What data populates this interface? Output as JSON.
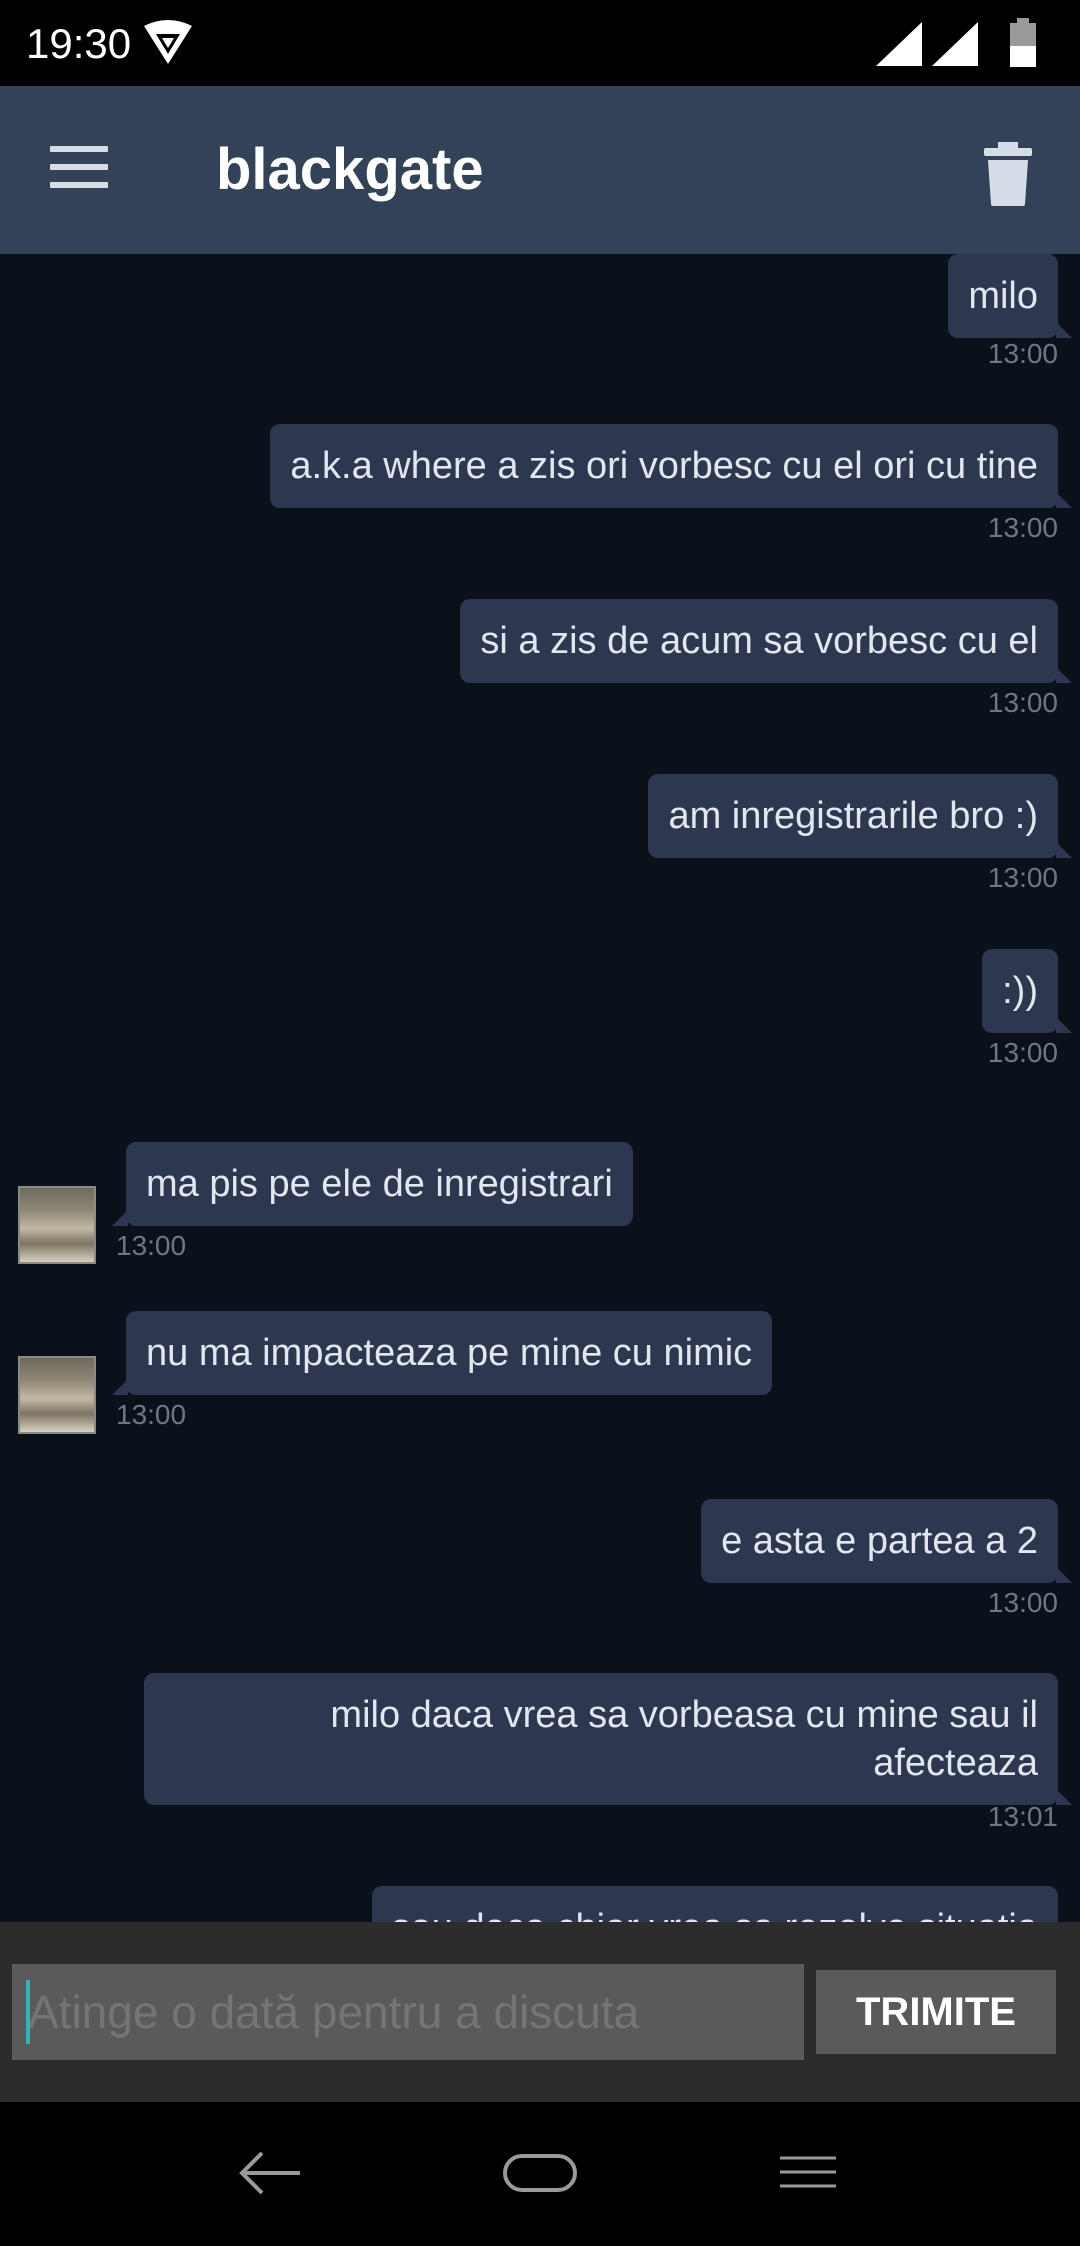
{
  "status_bar": {
    "time": "19:30"
  },
  "header": {
    "title": "blackgate"
  },
  "messages": [
    {
      "text": "milo",
      "time": "13:00"
    },
    {
      "text": "a.k.a where a zis ori vorbesc cu el ori cu tine",
      "time": "13:00"
    },
    {
      "text": "si a zis de acum sa vorbesc cu el",
      "time": "13:00"
    },
    {
      "text": "am inregistrarile bro :)",
      "time": "13:00"
    },
    {
      "text": ":))",
      "time": "13:00"
    },
    {
      "text": "ma pis pe ele de inregistrari",
      "time": "13:00"
    },
    {
      "text": "nu ma impacteaza pe mine cu nimic",
      "time": "13:00"
    },
    {
      "text": "e asta e partea a 2",
      "time": "13:00"
    },
    {
      "text": "milo daca vrea sa vorbeasa cu mine sau il afecteaza",
      "time": "13:01"
    },
    {
      "text": "sau daca chiar vrea sa rezolve situatia",
      "time": ""
    }
  ],
  "composer": {
    "placeholder": "Atinge o dată pentru a discuta",
    "send_label": "TRIMITE"
  },
  "colors": {
    "bubble": "#2d3750",
    "app_bar": "#334257",
    "background": "#0b111b",
    "cursor": "#34b3b8"
  }
}
